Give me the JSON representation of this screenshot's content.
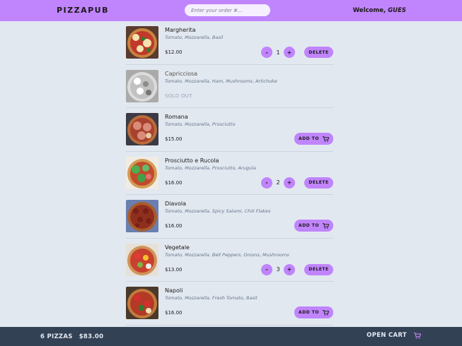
{
  "header": {
    "logo": "PIZZAPUB",
    "search_placeholder": "Enter your order #...",
    "welcome_prefix": "Welcome,",
    "user": "GUES"
  },
  "menu": [
    {
      "name": "Margherita",
      "ingredients": "Tomato, Mozzarella, Basil",
      "price": "$12.00",
      "sold_out": false,
      "in_cart": true,
      "quantity": "1",
      "delete_label": "DELETE",
      "decrease_label": "-",
      "increase_label": "+"
    },
    {
      "name": "Capricciosa",
      "ingredients": "Tomato, Mozzarella, Ham, Mushrooms, Artichoke",
      "sold_out": true,
      "sold_out_label": "SOLD OUT"
    },
    {
      "name": "Romana",
      "ingredients": "Tomato, Mozzarella, Prosciutto",
      "price": "$15.00",
      "sold_out": false,
      "in_cart": false,
      "add_label": "ADD TO"
    },
    {
      "name": "Prosciutto e Rucola",
      "ingredients": "Tomato, Mozzarella, Prosciutto, Arugula",
      "price": "$16.00",
      "sold_out": false,
      "in_cart": true,
      "quantity": "2",
      "delete_label": "DELETE",
      "decrease_label": "-",
      "increase_label": "+"
    },
    {
      "name": "Diavola",
      "ingredients": "Tomato, Mozzarella, Spicy Salami, Chili Flakes",
      "price": "$16.00",
      "sold_out": false,
      "in_cart": false,
      "add_label": "ADD TO"
    },
    {
      "name": "Vegetale",
      "ingredients": "Tomato, Mozzarella, Bell Peppers, Onions, Mushrooms",
      "price": "$13.00",
      "sold_out": false,
      "in_cart": true,
      "quantity": "3",
      "delete_label": "DELETE",
      "decrease_label": "-",
      "increase_label": "+"
    },
    {
      "name": "Napoli",
      "ingredients": "Tomato, Mozzarella, Fresh Tomato, Basil",
      "price": "$16.00",
      "sold_out": false,
      "in_cart": false,
      "add_label": "ADD TO"
    }
  ],
  "footer": {
    "pizza_count": "6 PIZZAS",
    "total": "$83.00",
    "open_cart_label": "OPEN CART"
  },
  "icons": {
    "cart": "cart-icon"
  },
  "colors": {
    "accent": "#c084fc",
    "background": "#e2e8f0",
    "footer": "#334155"
  }
}
